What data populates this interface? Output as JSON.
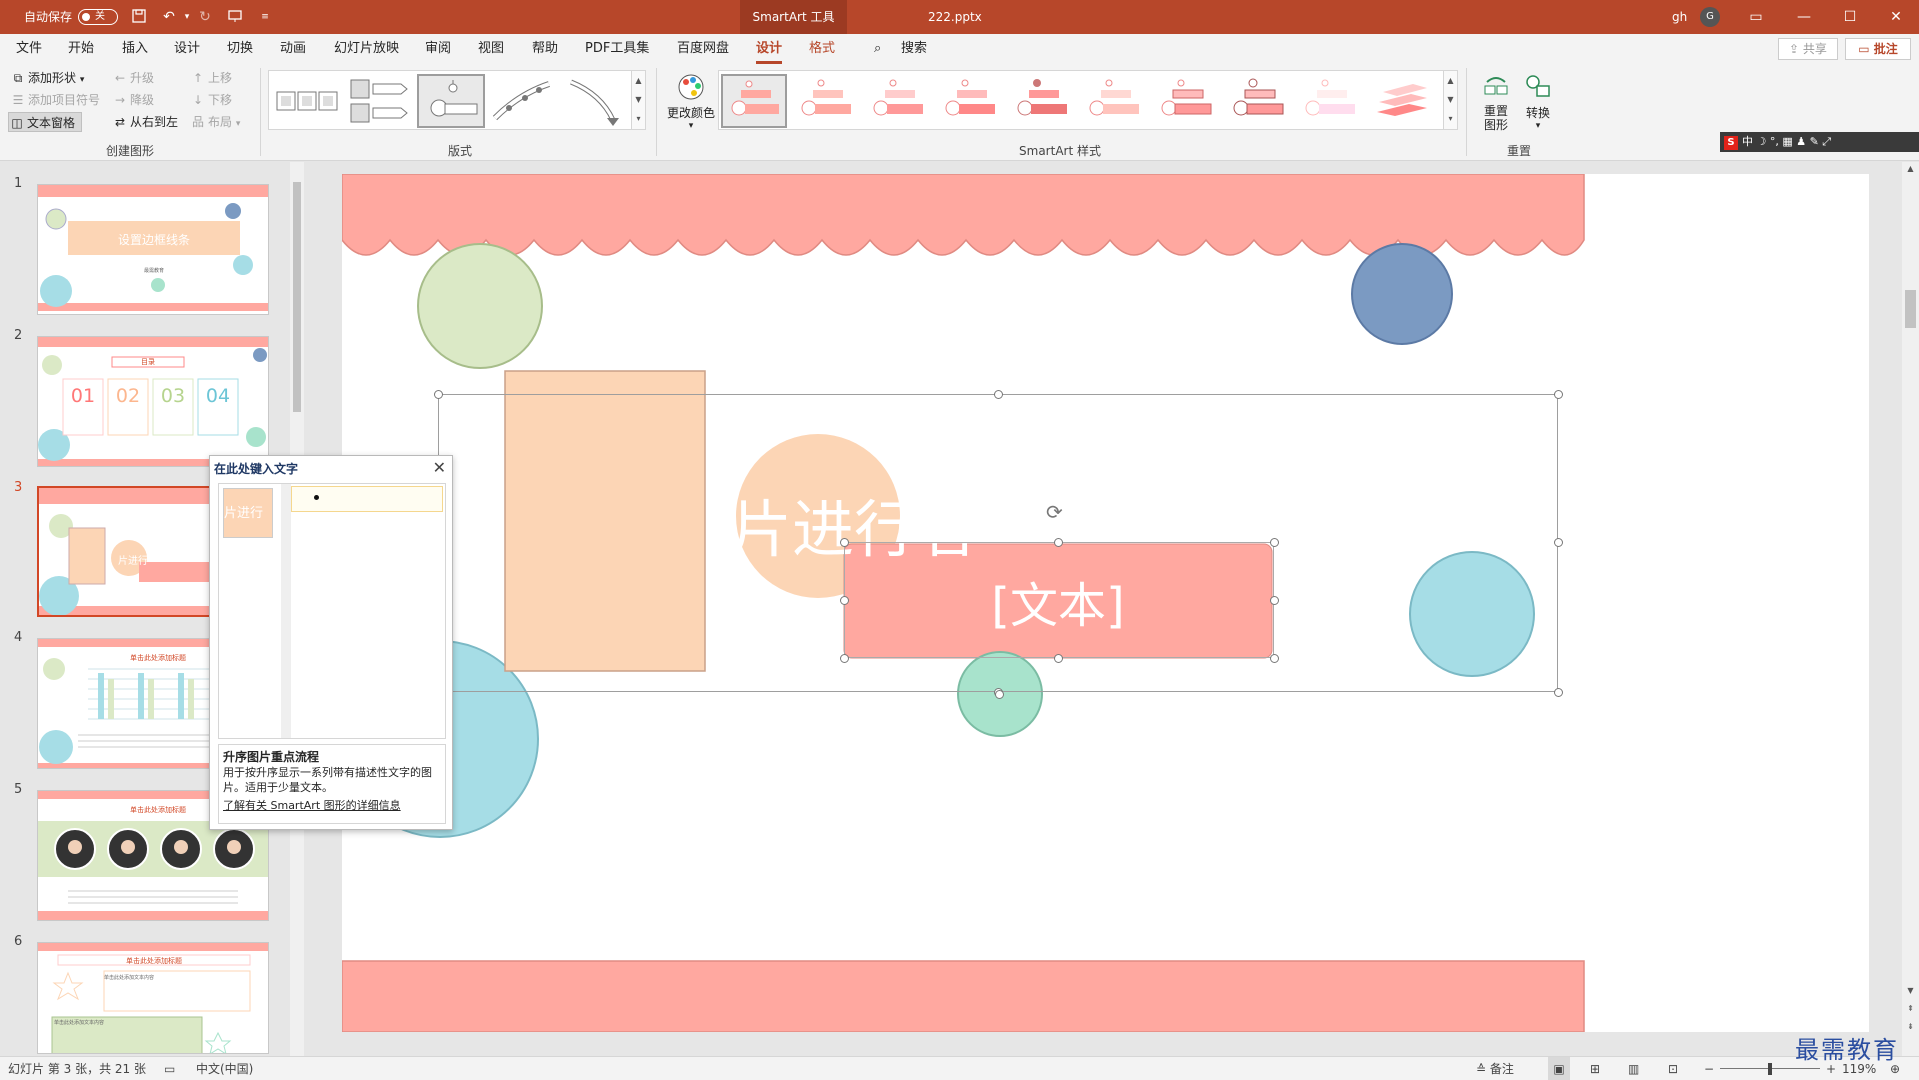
{
  "titlebar": {
    "autosave_label": "自动保存",
    "autosave_state": "关",
    "context_tab": "SmartArt 工具",
    "filename": "222.pptx",
    "user": "gh",
    "avatar_letter": "G"
  },
  "menu": {
    "tabs": [
      "文件",
      "开始",
      "插入",
      "设计",
      "切换",
      "动画",
      "幻灯片放映",
      "审阅",
      "视图",
      "帮助",
      "PDF工具集",
      "百度网盘",
      "设计",
      "格式"
    ],
    "active_index": 12,
    "search": "搜索",
    "share": "共享",
    "comments": "批注"
  },
  "ribbon": {
    "create_graphic": {
      "add_shape": "添加形状",
      "add_bullet": "添加项目符号",
      "text_pane": "文本窗格",
      "promote": "升级",
      "demote": "降级",
      "right_to_left": "从右到左",
      "move_up": "上移",
      "move_down": "下移",
      "layout": "布局",
      "label": "创建图形"
    },
    "layouts_label": "版式",
    "change_colors": "更改颜色",
    "styles_label": "SmartArt 样式",
    "reset_graphic": "重置图形",
    "convert": "转换",
    "reset_label": "重置"
  },
  "ime_bar": "中 ☽ °, ▦ ♟ ✎ ⤢",
  "thumbnails": [
    {
      "num": "1",
      "title": "设置边框线条",
      "subtitle": "最需教育"
    },
    {
      "num": "2",
      "title": "目录",
      "items": [
        "01",
        "02",
        "03",
        "04"
      ]
    },
    {
      "num": "3",
      "title": "片进行"
    },
    {
      "num": "4",
      "title": "单击此处添加标题"
    },
    {
      "num": "5",
      "title": "单击此处添加标题"
    },
    {
      "num": "6",
      "title": "单击此处添加标题",
      "box1": "单击此处添加文本内容",
      "box2": "单击此处添加文本内容"
    }
  ],
  "text_pane": {
    "title": "在此处键入文字",
    "pic_text": "片进行",
    "desc_title": "升序图片重点流程",
    "desc_text": "用于按升序显示一系列带有描述性文字的图片。适用于少量文本。",
    "link": "了解有关 SmartArt 图形的详细信息"
  },
  "slide": {
    "circle_text": "片进行者",
    "placeholder": "[文本]"
  },
  "status": {
    "slide_info": "幻灯片 第 3 张，共 21 张",
    "language": "中文(中国)",
    "notes": "备注",
    "zoom": "119%"
  },
  "watermark": "最需教育",
  "colors": {
    "accent": "#b7472a",
    "salmon": "#ffa8a0",
    "peach": "#fcd5b5",
    "green_circle": "#dbe9c6",
    "blue_circle": "#7b9ac2",
    "cyan_circle": "#a6dde6",
    "mint_circle": "#a8e3cc"
  }
}
